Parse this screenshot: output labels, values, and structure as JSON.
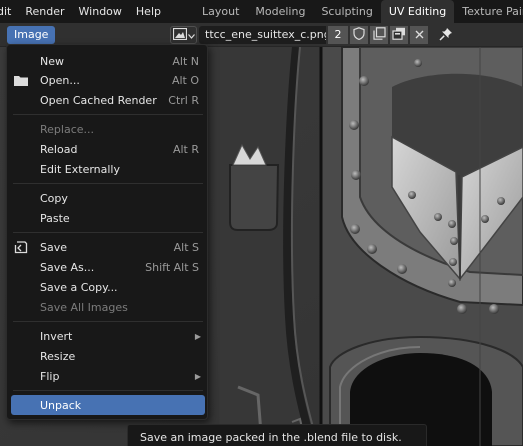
{
  "topbar": {
    "menus": [
      "dit",
      "Render",
      "Window",
      "Help"
    ],
    "workspaces": [
      "Layout",
      "Modeling",
      "Sculpting",
      "UV Editing",
      "Texture Paint"
    ],
    "active_workspace": "UV Editing"
  },
  "editor_header": {
    "image_menu_label": "Image",
    "image_name": "ttcc_ene_suittex_c.png",
    "user_count": "2"
  },
  "image_menu": {
    "items": [
      {
        "label": "New",
        "shortcut": "Alt N",
        "icon": "",
        "enabled": true,
        "submenu": false
      },
      {
        "label": "Open...",
        "shortcut": "Alt O",
        "icon": "folder-icon",
        "enabled": true,
        "submenu": false
      },
      {
        "label": "Open Cached Render",
        "shortcut": "Ctrl R",
        "icon": "",
        "enabled": true,
        "submenu": false
      },
      {
        "label": "Replace...",
        "shortcut": "",
        "icon": "",
        "enabled": false,
        "submenu": false
      },
      {
        "label": "Reload",
        "shortcut": "Alt R",
        "icon": "",
        "enabled": true,
        "submenu": false
      },
      {
        "label": "Edit Externally",
        "shortcut": "",
        "icon": "",
        "enabled": true,
        "submenu": false
      },
      {
        "label": "Copy",
        "shortcut": "",
        "icon": "",
        "enabled": true,
        "submenu": false
      },
      {
        "label": "Paste",
        "shortcut": "",
        "icon": "",
        "enabled": true,
        "submenu": false
      },
      {
        "label": "Save",
        "shortcut": "Alt S",
        "icon": "save-icon",
        "enabled": true,
        "submenu": false
      },
      {
        "label": "Save As...",
        "shortcut": "Shift Alt S",
        "icon": "",
        "enabled": true,
        "submenu": false
      },
      {
        "label": "Save a Copy...",
        "shortcut": "",
        "icon": "",
        "enabled": true,
        "submenu": false
      },
      {
        "label": "Save All Images",
        "shortcut": "",
        "icon": "",
        "enabled": false,
        "submenu": false
      },
      {
        "label": "Invert",
        "shortcut": "",
        "icon": "",
        "enabled": true,
        "submenu": true
      },
      {
        "label": "Resize",
        "shortcut": "",
        "icon": "",
        "enabled": true,
        "submenu": false
      },
      {
        "label": "Flip",
        "shortcut": "",
        "icon": "",
        "enabled": true,
        "submenu": true
      },
      {
        "label": "Unpack",
        "shortcut": "",
        "icon": "",
        "enabled": true,
        "submenu": false,
        "highlighted": true
      }
    ]
  },
  "tooltip": {
    "text": "Save an image packed in the .blend file to disk."
  },
  "colors": {
    "accent": "#4772b3",
    "menu_bg": "#181818",
    "header_bg": "#303030",
    "disabled_text": "#7c7c7c"
  }
}
